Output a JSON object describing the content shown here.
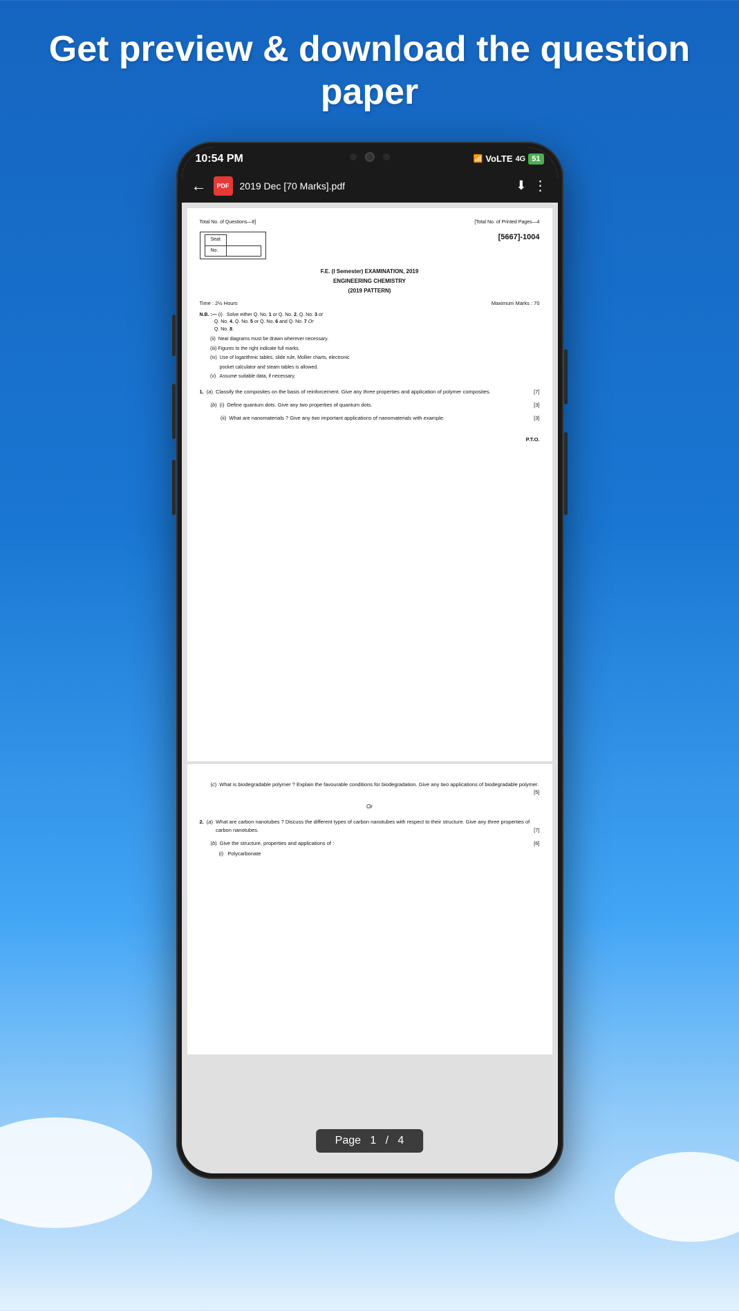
{
  "header": {
    "title": "Get preview & download the question paper"
  },
  "phone": {
    "status_bar": {
      "time": "10:54 PM",
      "battery": "51",
      "icons": "signal"
    },
    "toolbar": {
      "back_label": "←",
      "pdf_icon_label": "PDF",
      "file_name": "2019 Dec [70 Marks].pdf",
      "download_icon": "⬇",
      "more_icon": "⋮"
    },
    "page1": {
      "total_questions": "Total No. of Questions—8]",
      "total_pages": "[Total No. of Printed Pages—4",
      "seat_label": "Seat",
      "no_label": "No.",
      "paper_code": "[5667]-1004",
      "exam_title": "F.E. (I Semester)  EXAMINATION,  2019",
      "subject": "ENGINEERING  CHEMISTRY",
      "pattern": "(2019 PATTERN)",
      "time_label": "Time : 2½ Hours",
      "marks_label": "Maximum Marks : 70",
      "nb_heading": "N.B. :—",
      "instructions": [
        "(i)   Solve either Q. No. 1 or Q. No. 2, Q. No. 3 or Q. No. 4, Q. No. 5 or Q. No. 6 and Q. No. 7 Or Q. No. 8.",
        "(ii)  Neat diagrams must be drawn wherever necessary.",
        "(iii) Figures to the right indicate full marks.",
        "(iv)  Use of logarithmic tables, slide rule, Mollier charts, electronic pocket calculator and steam tables is allowed.",
        "(v)   Assume suitable data, if necessary."
      ],
      "questions": [
        {
          "number": "1.",
          "part": "(a)",
          "text": "Classify the composites on the basis of reinforcement. Give any three properties and application of polymer composites.",
          "marks": "[7]"
        },
        {
          "number": "",
          "part": "(b)",
          "subpart": "(i)",
          "text": "Define quantum dots. Give any two properties of quantum dots.",
          "marks": "[3]"
        },
        {
          "number": "",
          "part": "",
          "subpart": "(ii)",
          "text": "What are nanomaterials ? Give any two important applications of nanomaterials with example.",
          "marks": "[3]"
        }
      ],
      "pto": "P.T.O."
    },
    "page2": {
      "questions": [
        {
          "part": "(c)",
          "text": "What is biodegradable polymer ? Explain the favourable conditions for biodegradation. Give any two applications of biodegradable polymer.",
          "marks": "[5]"
        },
        {
          "divider": "Or"
        },
        {
          "number": "2.",
          "part": "(a)",
          "text": "What are carbon nanotubes ? Discuss the different types of carbon nanotubes with respect to their structure. Give any three properties of carbon nanotubes.",
          "marks": "[7]"
        },
        {
          "number": "",
          "part": "(b)",
          "text": "Give the structure, properties and applications of :",
          "marks": "[6]",
          "subitems": [
            "(i)   Polycarbonate"
          ]
        }
      ]
    },
    "page_indicator": {
      "label": "Page",
      "current": "1",
      "separator": "/",
      "total": "4"
    }
  }
}
